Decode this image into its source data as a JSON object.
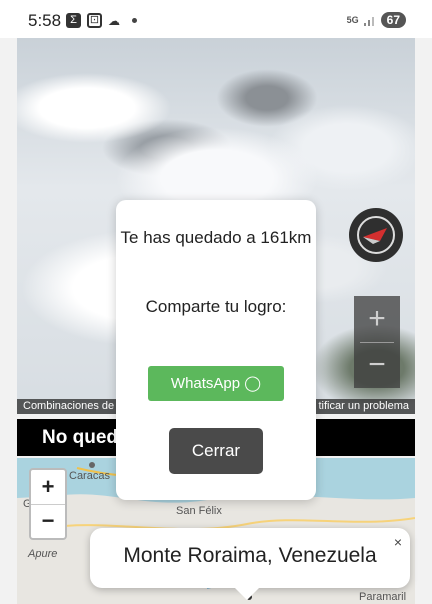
{
  "status": {
    "time": "5:58",
    "network": "5G",
    "battery": "67"
  },
  "photo_attribution": {
    "left": "Combinaciones de",
    "right": "tificar un problema"
  },
  "result_bar": {
    "text": "No qued                              : 161km"
  },
  "modal": {
    "message": "Te has quedado a 161km",
    "share_prompt": "Comparte tu logro:",
    "whatsapp_label": "WhatsApp ◯",
    "close_label": "Cerrar"
  },
  "map": {
    "labels": [
      "Caracas",
      "San Félix",
      "Apure",
      "Paramaril",
      "G"
    ],
    "zoom_in": "+",
    "zoom_out": "−"
  },
  "popup": {
    "location": "Monte Roraima, Venezuela",
    "close": "×"
  },
  "streetview_zoom": {
    "in": "+",
    "out": "−"
  }
}
